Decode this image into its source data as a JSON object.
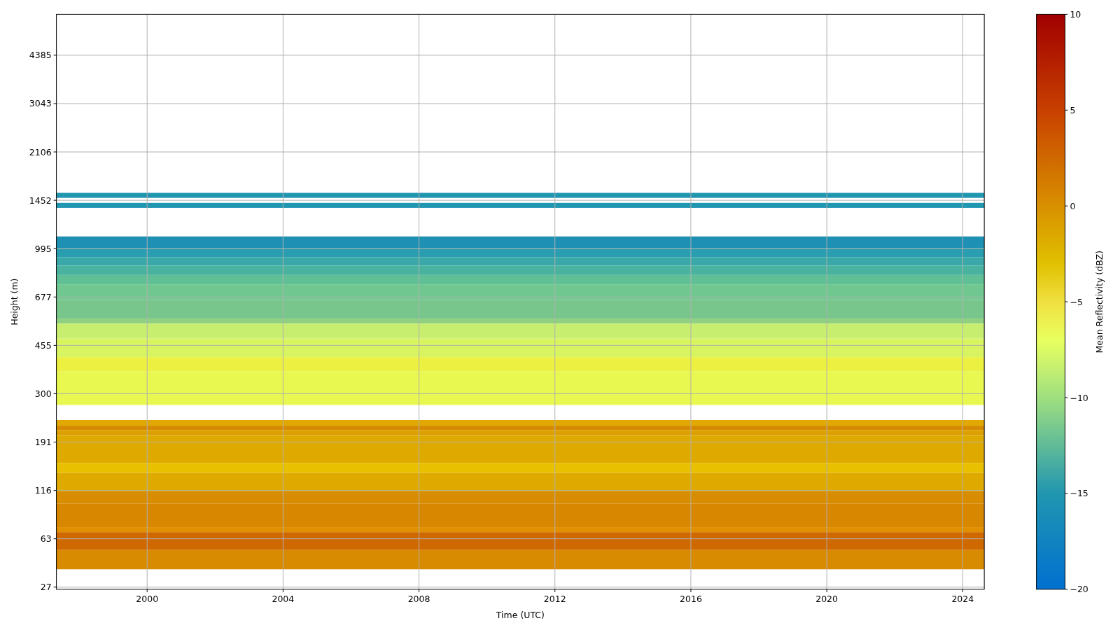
{
  "plot": {
    "xlabel": "Time (UTC)",
    "ylabel": "Height (m)",
    "xticks": [
      "2000",
      "2004",
      "2008",
      "2012",
      "2016",
      "2020",
      "2024"
    ],
    "yticks": [
      "4385",
      "3043",
      "2106",
      "1452",
      "995",
      "677",
      "455",
      "300",
      "191",
      "116",
      "63",
      "27"
    ]
  },
  "colorbar": {
    "label": "Mean Reflectivity (dBZ)",
    "ticks": [
      "10",
      "5",
      "0",
      "−5",
      "−10",
      "−15",
      "−20"
    ]
  }
}
